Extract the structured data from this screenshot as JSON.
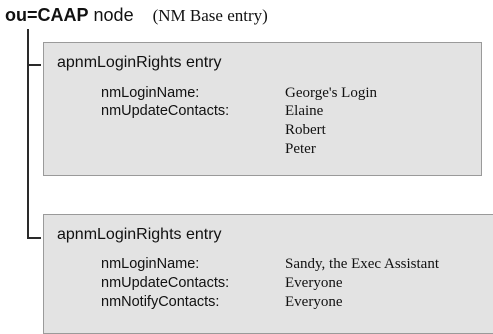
{
  "root": {
    "ou_label": "ou=CAAP",
    "node_label": "node",
    "note": "(NM Base entry)"
  },
  "entries": [
    {
      "title": "apnmLoginRights entry",
      "attributes": [
        {
          "name": "nmLoginName:",
          "values": [
            "George's Login"
          ]
        },
        {
          "name": "nmUpdateContacts:",
          "values": [
            "Elaine",
            "Robert",
            "Peter"
          ]
        }
      ]
    },
    {
      "title": "apnmLoginRights entry",
      "attributes": [
        {
          "name": "nmLoginName:",
          "values": [
            "Sandy, the Exec Assistant"
          ]
        },
        {
          "name": "nmUpdateContacts:",
          "values": [
            "Everyone"
          ]
        },
        {
          "name": "nmNotifyContacts:",
          "values": [
            "Everyone"
          ]
        }
      ]
    }
  ]
}
